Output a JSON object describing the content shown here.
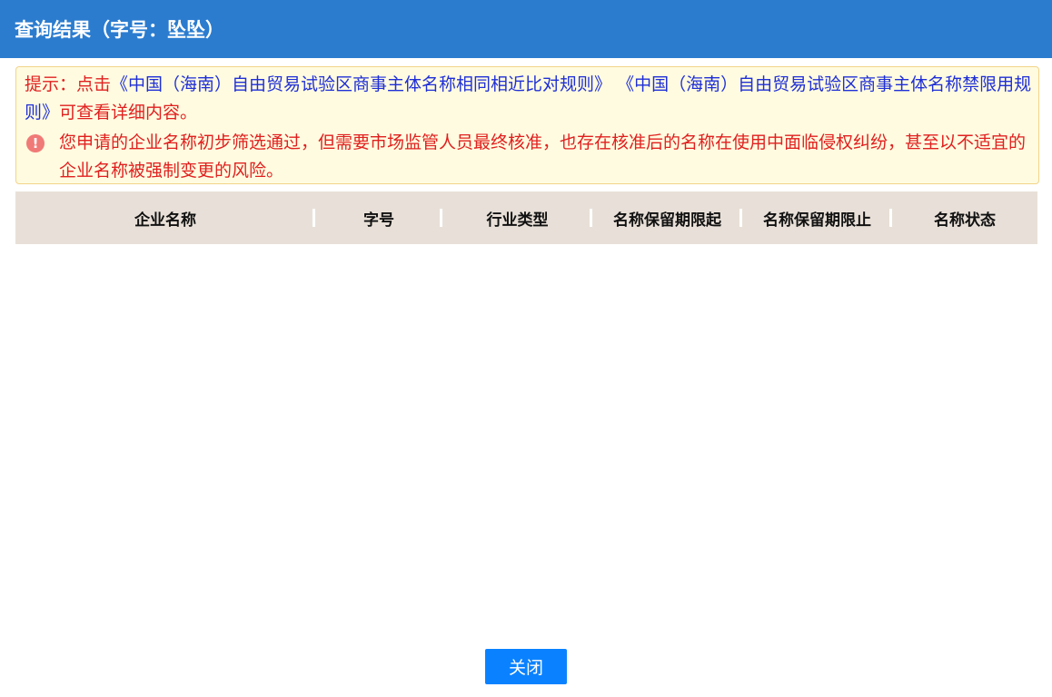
{
  "header": {
    "title": "查询结果（字号：坠坠）"
  },
  "notice": {
    "prefix": "提示：点击",
    "rule_link_1": "《中国（海南）自由贸易试验区商事主体名称相同相近比对规则》",
    "rule_link_2": "《中国（海南）自由贸易试验区商事主体名称禁限用规则》",
    "suffix": "可查看详细内容。",
    "warning": "您申请的企业名称初步筛选通过，但需要市场监管人员最终核准，也存在核准后的名称在使用中面临侵权纠纷，甚至以不适宜的企业名称被强制变更的风险。"
  },
  "table": {
    "columns": [
      "企业名称",
      "字号",
      "行业类型",
      "名称保留期限起",
      "名称保留期限止",
      "名称状态"
    ],
    "rows": []
  },
  "footer": {
    "close_label": "关闭"
  },
  "colors": {
    "header_bg": "#2b7ccf",
    "notice_bg": "#fffbe0",
    "link": "#1f2fd6",
    "warning_text": "#e0201f",
    "button": "#0a82ff"
  }
}
